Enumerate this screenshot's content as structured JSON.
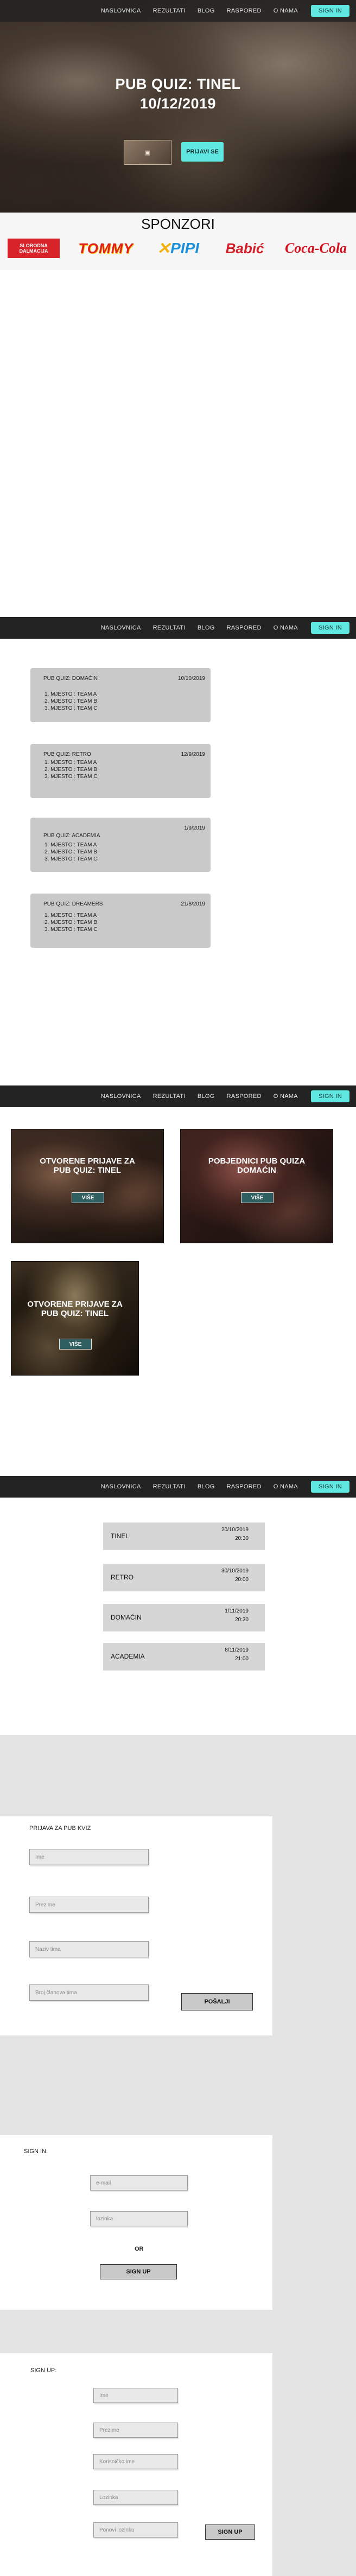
{
  "nav": {
    "items": [
      "NASLOVNICA",
      "REZULTATI",
      "BLOG",
      "RASPORED",
      "O NAMA"
    ],
    "sign_in": "SIGN IN"
  },
  "hero": {
    "title_line1": "PUB QUIZ: TINEL",
    "title_line2": "10/12/2019",
    "prijavi_label": "PRIJAVI SE"
  },
  "sponsors": {
    "title": "SPONZORI",
    "logos": [
      "SLOBODNA DALMACIJA",
      "TOMMY",
      "PIPI",
      "Babić",
      "Coca-Cola"
    ]
  },
  "results": [
    {
      "title": "PUB QUIZ: DOMAĆIN",
      "date": "10/10/2019",
      "lines": [
        "1. MJESTO : TEAM A",
        "2. MJESTO : TEAM B",
        "3. MJESTO : TEAM C"
      ]
    },
    {
      "title": "PUB QUIZ: RETRO",
      "date": "12/9/2019",
      "lines": [
        "1. MJESTO : TEAM A",
        "2. MJESTO : TEAM B",
        "3. MJESTO : TEAM C"
      ]
    },
    {
      "title": "PUB QUIZ: ACADEMIA",
      "date": "1/9/2019",
      "lines": [
        "1. MJESTO : TEAM A",
        "2. MJESTO : TEAM B",
        "3. MJESTO : TEAM C"
      ]
    },
    {
      "title": "PUB QUIZ: DREAMERS",
      "date": "21/8/2019",
      "lines": [
        "1. MJESTO : TEAM A",
        "2. MJESTO : TEAM B",
        "3. MJESTO : TEAM C"
      ]
    }
  ],
  "blog": {
    "cards": [
      {
        "caption": "OTVORENE PRIJAVE ZA PUB QUIZ: TINEL",
        "button": "VIŠE"
      },
      {
        "caption": "POBJEDNICI PUB QUIZA DOMAĆIN",
        "button": "VIŠE"
      },
      {
        "caption": "OTVORENE PRIJAVE ZA PUB QUIZ: TINEL",
        "button": "VIŠE"
      }
    ]
  },
  "schedule": [
    {
      "name": "TINEL",
      "date": "20/10/2019",
      "time": "20:30"
    },
    {
      "name": "RETRO",
      "date": "30/10/2019",
      "time": "20:00"
    },
    {
      "name": "DOMAĆIN",
      "date": "1/11/2019",
      "time": "20:30"
    },
    {
      "name": "ACADEMIA",
      "date": "8/11/2019",
      "time": "21:00"
    }
  ],
  "signup_quiz": {
    "title": "PRIJAVA ZA PUB KVIZ",
    "placeholders": [
      "Ime",
      "Prezime",
      "Naziv tima",
      "Broj članova tima"
    ],
    "submit": "POŠALJI"
  },
  "login": {
    "title": "SIGN IN:",
    "placeholders": [
      "e-mail",
      "lozinka"
    ],
    "or": "OR",
    "signup_btn": "SIGN UP"
  },
  "register": {
    "title": "SIGN UP:",
    "placeholders": [
      "Ime",
      "Prezime",
      "Korisničko ime",
      "Lozinka",
      "Ponovi lozinku"
    ],
    "submit": "SIGN UP"
  },
  "colors": {
    "accent": "#5fe8e1",
    "nav_bg": "#232323",
    "card_grey": "#c9c9c9",
    "page_grey": "#e4e4e4"
  }
}
